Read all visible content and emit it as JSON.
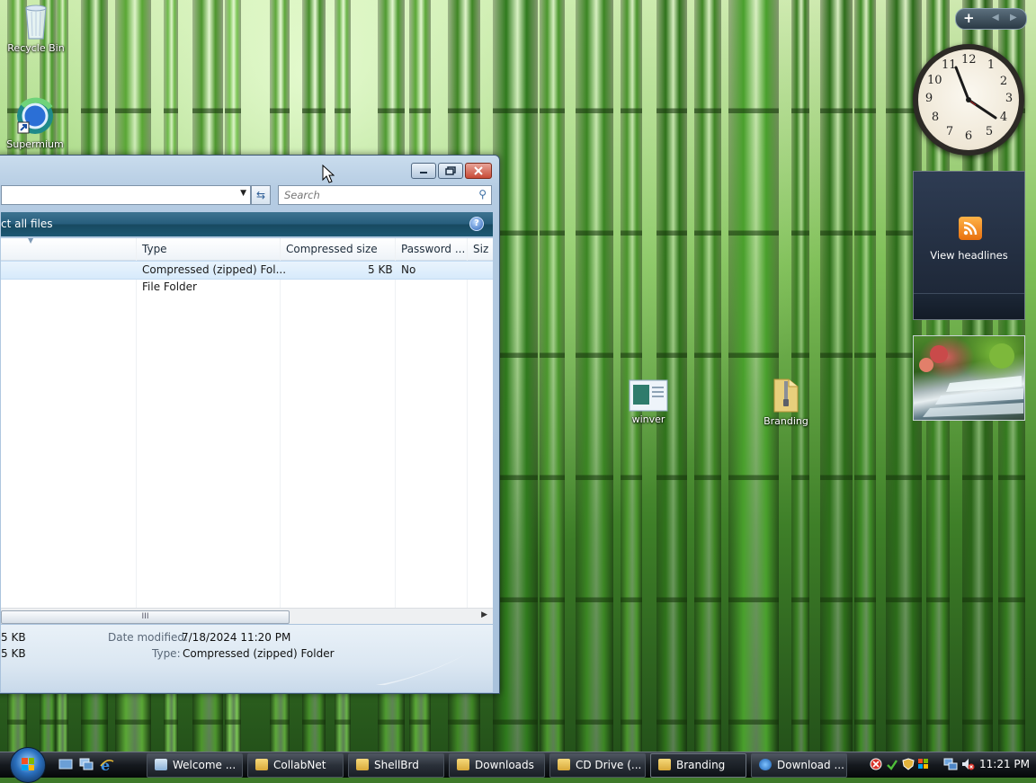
{
  "desktop": {
    "icons": {
      "recycle_bin": "Recycle Bin",
      "supermium": "Supermium",
      "winver": "winver",
      "branding": "Branding"
    }
  },
  "window": {
    "search_placeholder": "Search",
    "command_bar": {
      "extract_label": "ct all files",
      "help_glyph": "?"
    },
    "columns": {
      "type": "Type",
      "compressed_size": "Compressed size",
      "password": "Password ...",
      "size": "Siz"
    },
    "rows": [
      {
        "type": "Compressed (zipped) Fol...",
        "compressed_size": "5 KB",
        "password": "No"
      },
      {
        "type": "File Folder",
        "compressed_size": "",
        "password": ""
      }
    ],
    "scroll_thumb_glyph": "III",
    "details": {
      "size_line_1": "5 KB",
      "size_line_2": "5 KB",
      "date_modified_label": "Date modified:",
      "date_modified_value": "7/18/2024 11:20 PM",
      "type_label": "Type:",
      "type_value": "Compressed (zipped) Folder"
    }
  },
  "gadgets": {
    "rss_label": "View headlines",
    "clock_numbers": [
      "12",
      "1",
      "2",
      "3",
      "4",
      "5",
      "6",
      "7",
      "8",
      "9",
      "10",
      "11"
    ]
  },
  "taskbar": {
    "buttons": [
      {
        "label": "Welcome ...",
        "active": false
      },
      {
        "label": "CollabNet",
        "active": false
      },
      {
        "label": "ShellBrd",
        "active": false
      },
      {
        "label": "Downloads",
        "active": false
      },
      {
        "label": "CD Drive (...",
        "active": false
      },
      {
        "label": "Branding",
        "active": true
      },
      {
        "label": "Download ...",
        "active": false
      }
    ],
    "time": "11:21 PM"
  },
  "colors": {
    "command_bar": "#1d5873",
    "selection": "#d7eafb",
    "taskbar": "#15191e"
  }
}
